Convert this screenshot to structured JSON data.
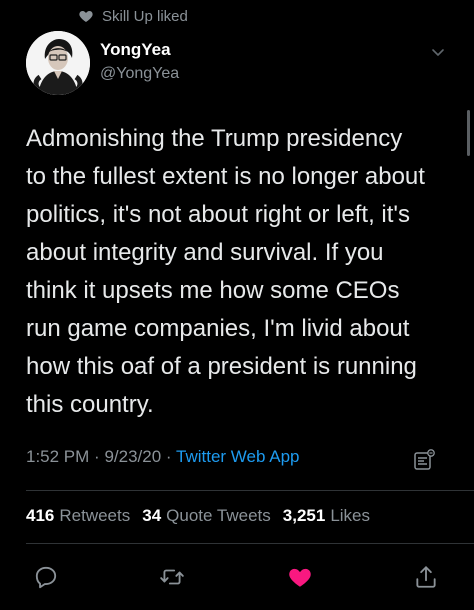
{
  "social_context": {
    "icon": "heart-icon",
    "text": "Skill Up liked"
  },
  "author": {
    "display_name": "YongYea",
    "handle": "@YongYea",
    "avatar": "avatar"
  },
  "tweet": {
    "text": "Admonishing the Trump presidency\nto the fullest extent is no longer about\npolitics, it's not about right or left, it's\nabout integrity and survival. If you\nthink it upsets me how some CEOs\nrun game companies, I'm livid about\nhow this oaf of a president is running\nthis country.",
    "time": "1:52 PM",
    "separator": "·",
    "date": "9/23/20",
    "source": "Twitter Web App"
  },
  "stats": {
    "retweets_count": "416",
    "retweets_label": "Retweets",
    "quotes_count": "34",
    "quotes_label": "Quote Tweets",
    "likes_count": "3,251",
    "likes_label": "Likes"
  },
  "actions": [
    "reply-icon",
    "retweet-icon",
    "like-icon",
    "share-icon"
  ],
  "colors": {
    "background": "#000000",
    "text": "#e7e9ea",
    "muted": "#8b9298",
    "link": "#1d9bf0",
    "like": "#f91880",
    "divider": "#2f3336"
  }
}
